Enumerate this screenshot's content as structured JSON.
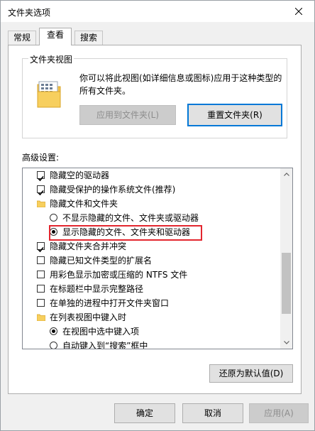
{
  "window": {
    "title": "文件夹选项"
  },
  "tabs": [
    {
      "label": "常规"
    },
    {
      "label": "查看"
    },
    {
      "label": "搜索"
    }
  ],
  "folder_views": {
    "legend": "文件夹视图",
    "description": "你可以将此视图(如详细信息或图标)应用于这种类型的所有文件夹。",
    "apply_button": "应用到文件夹(L)",
    "reset_button": "重置文件夹(R)"
  },
  "advanced": {
    "label": "高级设置:",
    "items": [
      {
        "type": "checkbox",
        "checked": true,
        "label": "隐藏空的驱动器"
      },
      {
        "type": "checkbox",
        "checked": true,
        "label": "隐藏受保护的操作系统文件(推荐)"
      },
      {
        "type": "folder",
        "label": "隐藏文件和文件夹"
      },
      {
        "type": "radio",
        "checked": false,
        "label": "不显示隐藏的文件、文件夹或驱动器"
      },
      {
        "type": "radio",
        "checked": true,
        "label": "显示隐藏的文件、文件夹和驱动器"
      },
      {
        "type": "checkbox",
        "checked": true,
        "label": "隐藏文件夹合并冲突"
      },
      {
        "type": "checkbox",
        "checked": false,
        "label": "隐藏已知文件类型的扩展名"
      },
      {
        "type": "checkbox",
        "checked": false,
        "label": "用彩色显示加密或压缩的 NTFS 文件"
      },
      {
        "type": "checkbox",
        "checked": false,
        "label": "在标题栏中显示完整路径"
      },
      {
        "type": "checkbox",
        "checked": false,
        "label": "在单独的进程中打开文件夹窗口"
      },
      {
        "type": "folder",
        "label": "在列表视图中键入时"
      },
      {
        "type": "radio",
        "checked": true,
        "label": "在视图中选中键入项"
      },
      {
        "type": "radio",
        "checked": false,
        "label": "自动键入到“搜索”框中"
      }
    ],
    "restore_button": "还原为默认值(D)"
  },
  "footer": {
    "ok": "确定",
    "cancel": "取消",
    "apply": "应用(A)"
  },
  "colors": {
    "highlight": "#e3262e",
    "accent": "#0078d7"
  }
}
